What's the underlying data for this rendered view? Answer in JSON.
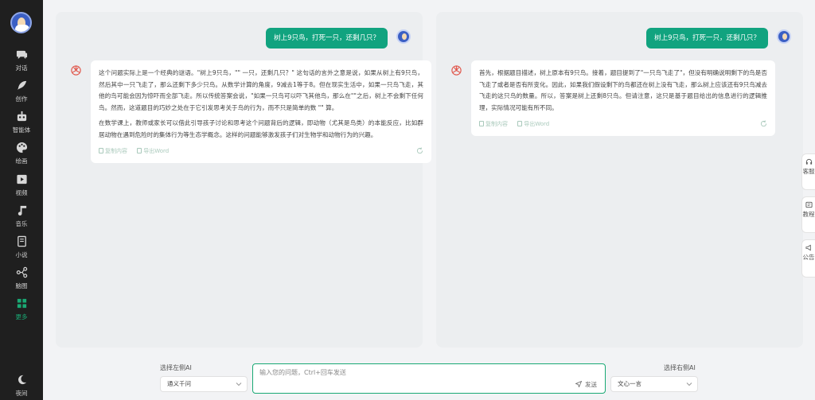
{
  "sidebar": {
    "items": [
      {
        "icon": "chat-bubble-icon",
        "label": "对话"
      },
      {
        "icon": "feather-icon",
        "label": "创作"
      },
      {
        "icon": "robot-icon",
        "label": "智能体"
      },
      {
        "icon": "palette-icon",
        "label": "绘画"
      },
      {
        "icon": "video-play-icon",
        "label": "视频"
      },
      {
        "icon": "music-note-icon",
        "label": "音乐"
      },
      {
        "icon": "book-icon",
        "label": "小说"
      },
      {
        "icon": "mind-map-icon",
        "label": "脑图"
      },
      {
        "icon": "grid-icon",
        "label": "更多"
      }
    ],
    "active_index": 8,
    "night_mode": {
      "icon": "moon-icon",
      "label": "夜间"
    }
  },
  "left_panel": {
    "user_message": "树上9只鸟，打死一只，还剩几只？",
    "ai_paragraphs": [
      "这个问题实际上是一个经典的谜语。\"树上9只鸟，\"\" 一只，还剩几只？\" 这句话的言外之意是说，如果从树上有9只鸟，然后其中一只飞走了，那么还剩下多少只鸟。从数学计算的角度，9减去1等于8。但在现实生活中，如果一只鸟飞走，其他的鸟可能会因为惊吓而全部飞走。所以传统答案会说，\"如果一只鸟可以吓飞其他鸟，那么在\"\"之后，树上不会剩下任何鸟。然而，这道题目的巧妙之处在于它引发思考关于鸟的行为，而不只是简单的数 \"\" 算。",
      "在数学课上，教师或家长可以借此引导孩子讨论和思考这个问题背后的逻辑，即动物（尤其是鸟类）的本能反应，比如群居动物在遇到危险时的集体行为等生态学概念。这样的问题能够激发孩子们对生物学和动物行为的兴趣。"
    ],
    "copy_label": "复制内容",
    "export_label": "导出Word"
  },
  "right_panel": {
    "user_message": "树上9只鸟，打死一只，还剩几只？",
    "ai_paragraphs": [
      "首先，根据题目描述，树上原本有9只鸟。接着，题目提到了\"一只鸟飞走了\"，但没有明确说明剩下的鸟是否飞走了或者是否有所变化。因此，如果我们假设剩下的鸟都还在树上没有飞走，那么树上应该还有9只鸟减去飞走的这只鸟的数量。所以，答案是树上还剩8只鸟。但请注意，这只是基于题目给出的信息进行的逻辑推理，实际情况可能有所不同。"
    ],
    "copy_label": "复制内容",
    "export_label": "导出Word"
  },
  "float_buttons": [
    {
      "icon": "headset-icon",
      "label": "客服"
    },
    {
      "icon": "tutorial-icon",
      "label": "教程"
    },
    {
      "icon": "announcement-icon",
      "label": "公告"
    }
  ],
  "bottom": {
    "left_select_label": "选择左侧AI",
    "left_select_value": "通义千问",
    "right_select_label": "选择右侧AI",
    "right_select_value": "文心一言",
    "input_placeholder": "输入您的问题，Ctrl+回车发送",
    "send_label": "发送"
  },
  "colors": {
    "accent": "#11a37f",
    "sidebar_bg": "#1f1f1f",
    "panel_bg": "#eceef0",
    "openai_icon": "#e0564b"
  }
}
